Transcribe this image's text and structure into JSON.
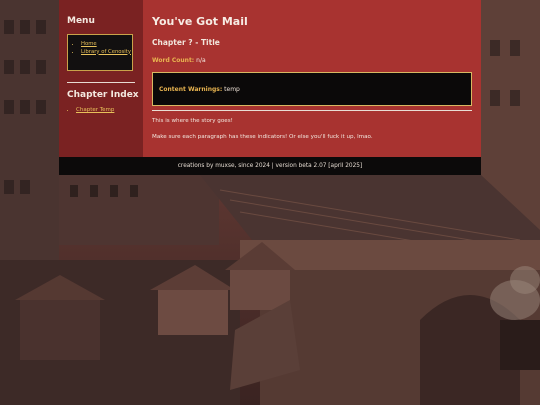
{
  "menu": {
    "title": "Menu",
    "items": [
      {
        "label": "Home"
      },
      {
        "label": "Library of Cenosity"
      }
    ]
  },
  "chapter_index": {
    "title": "Chapter Index",
    "items": [
      {
        "label": "Chapter Temp"
      }
    ]
  },
  "story": {
    "title": "You've Got Mail",
    "chapter_heading": "Chapter ? - Title",
    "word_count_label": "Word Count:",
    "word_count_value": "n/a",
    "warnings_label": "Content Warnings:",
    "warnings_value": "temp",
    "paragraphs": [
      "This is where the story goes!",
      "Make sure each paragraph has these indicators! Or else you'll fuck it up, lmao."
    ]
  },
  "footer": {
    "text": "creations by muxse, since 2024 | version beta 2.07 [april 2025]"
  },
  "colors": {
    "sidebar_bg": "#7a2222",
    "main_bg": "#a83330",
    "accent_gold": "#e8b450",
    "link_gold": "#e8c15a",
    "box_bg": "#0b0909",
    "footer_bg": "#0c0a0a"
  }
}
